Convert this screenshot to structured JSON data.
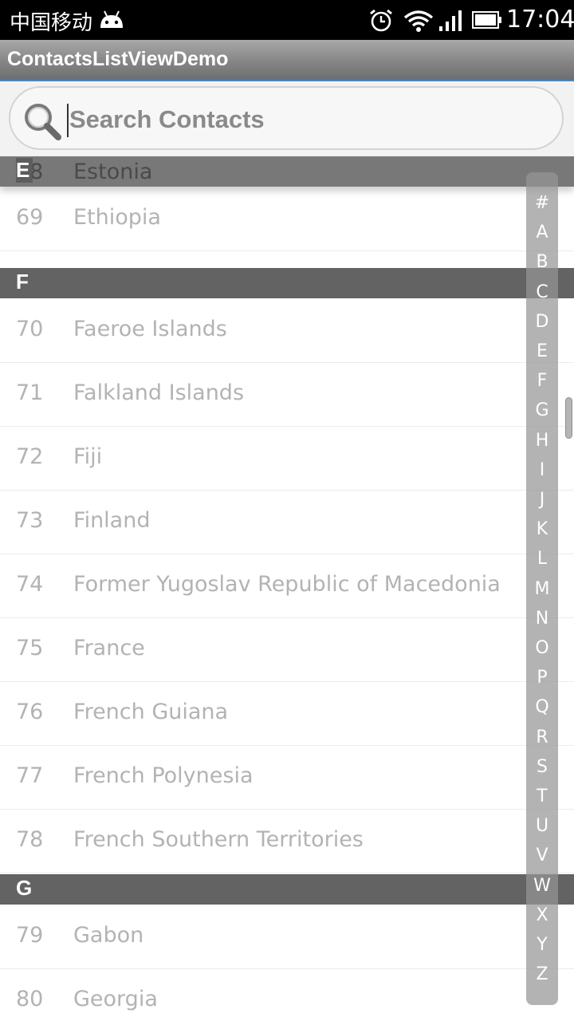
{
  "status_bar": {
    "carrier": "中国移动",
    "time": "17:04"
  },
  "app": {
    "title": "ContactsListViewDemo"
  },
  "search": {
    "placeholder": "Search Contacts"
  },
  "pinned_section": {
    "letter": "E",
    "partial_row_number": "68",
    "partial_row_name": "Estonia"
  },
  "list": {
    "rows": [
      {
        "number": "69",
        "name": "Ethiopia"
      },
      {
        "number": "70",
        "name": "Faeroe Islands"
      },
      {
        "number": "71",
        "name": "Falkland Islands"
      },
      {
        "number": "72",
        "name": "Fiji"
      },
      {
        "number": "73",
        "name": "Finland"
      },
      {
        "number": "74",
        "name": "Former Yugoslav Republic of Macedonia"
      },
      {
        "number": "75",
        "name": "France"
      },
      {
        "number": "76",
        "name": "French Guiana"
      },
      {
        "number": "77",
        "name": "French Polynesia"
      },
      {
        "number": "78",
        "name": "French Southern Territories"
      },
      {
        "number": "79",
        "name": "Gabon"
      },
      {
        "number": "80",
        "name": "Georgia"
      }
    ],
    "sections": [
      {
        "letter": "F"
      },
      {
        "letter": "G"
      }
    ]
  },
  "index_bar": {
    "letters": [
      "#",
      "A",
      "B",
      "C",
      "D",
      "E",
      "F",
      "G",
      "H",
      "I",
      "J",
      "K",
      "L",
      "M",
      "N",
      "O",
      "P",
      "Q",
      "R",
      "S",
      "T",
      "U",
      "V",
      "W",
      "X",
      "Y",
      "Z"
    ]
  }
}
